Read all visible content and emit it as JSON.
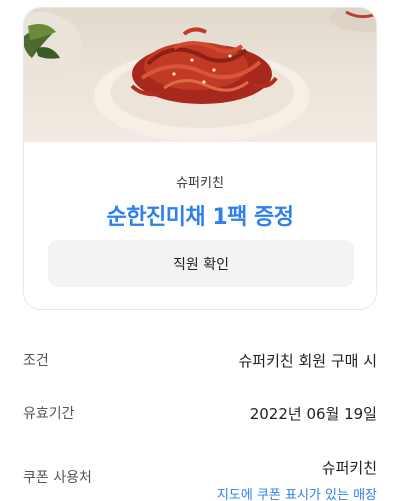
{
  "coupon": {
    "brand": "슈퍼키친",
    "title": "순한진미채 1팩 증정",
    "staff_button": "직원 확인"
  },
  "details": {
    "condition": {
      "label": "조건",
      "value": "슈퍼키친 회원 구매 시"
    },
    "validity": {
      "label": "유효기간",
      "value": "2022년 06월 19일"
    },
    "place": {
      "label": "쿠폰 사용처",
      "value": "슈퍼키친",
      "link": "지도에 쿠폰 표시가 있는 매장"
    }
  },
  "colors": {
    "accent": "#2f80ed",
    "button_bg": "#f2f3f5",
    "border": "#e6e8eb"
  }
}
